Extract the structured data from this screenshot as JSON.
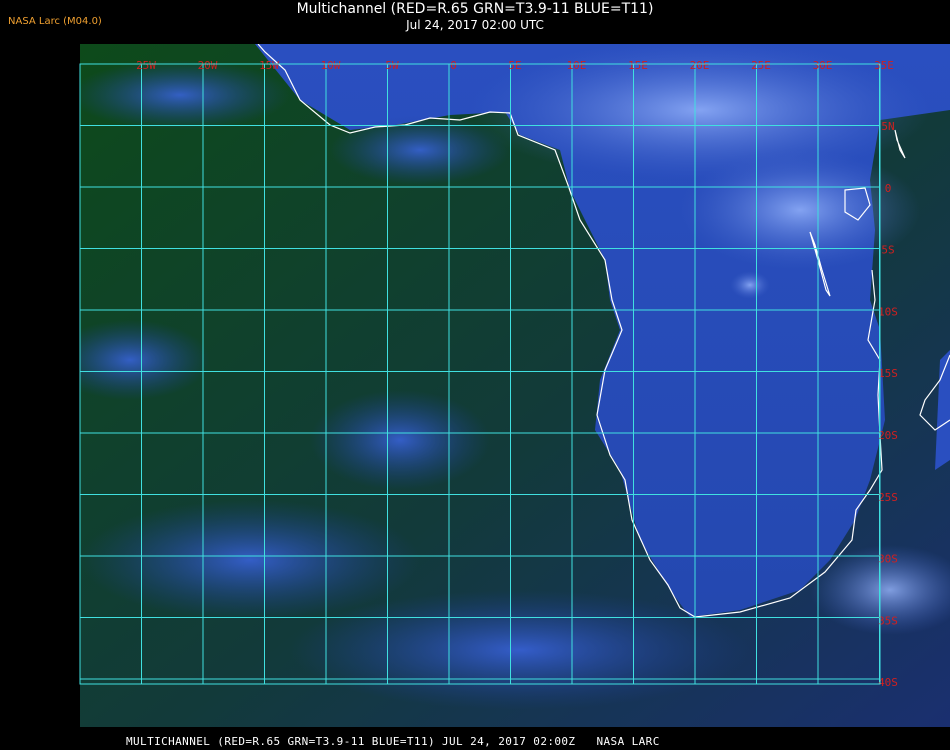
{
  "header": {
    "credit": "NASA Larc (M04.0)",
    "title": "Multichannel (RED=R.65 GRN=T3.9-11 BLUE=T11)",
    "subtitle": "Jul 24, 2017 02:00 UTC"
  },
  "grid": {
    "longitude_labels": [
      "25W",
      "20W",
      "15W",
      "10W",
      "5W",
      "0",
      "5E",
      "10E",
      "15E",
      "20E",
      "25E",
      "30E",
      "35E"
    ],
    "latitude_labels": [
      "5N",
      "0",
      "5S",
      "10S",
      "15S",
      "20S",
      "25S",
      "30S",
      "35S",
      "40S"
    ],
    "grid_color": "#40e0e0",
    "label_color": "#d02020"
  },
  "imagery": {
    "ocean_color": "#0a3a18",
    "cloud_color": "#2850d0",
    "bright_cloud_color": "#8fb0ff",
    "coastline_color": "#ffffff"
  },
  "footer": {
    "text": "MULTICHANNEL (RED=R.65 GRN=T3.9-11 BLUE=T11) JUL 24, 2017 02:00Z   NASA LARC"
  }
}
